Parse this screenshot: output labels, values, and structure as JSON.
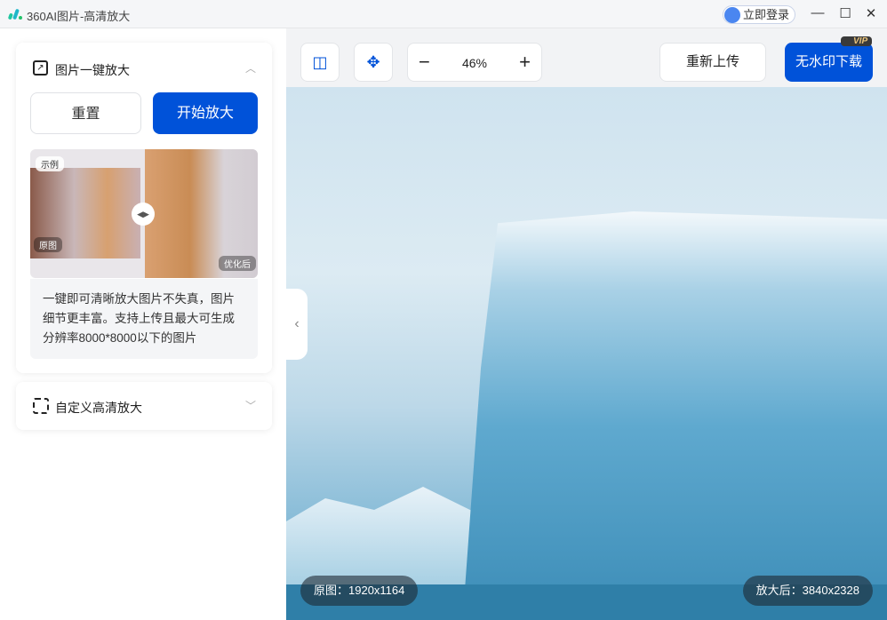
{
  "titlebar": {
    "title": "360AI图片-高清放大",
    "login": "立即登录",
    "minimize": "—",
    "maximize": "☐",
    "close": "✕"
  },
  "sidebar": {
    "section1": {
      "title": "图片一键放大",
      "reset": "重置",
      "start": "开始放大",
      "example_tag": "示例",
      "before_tag": "原图",
      "after_tag": "优化后",
      "description": "一键即可清晰放大图片不失真，图片细节更丰富。支持上传且最大可生成分辨率8000*8000以下的图片"
    },
    "section2": {
      "title": "自定义高清放大"
    }
  },
  "toolbar": {
    "zoom": "46%",
    "zoom_out": "−",
    "zoom_in": "+",
    "reupload": "重新上传",
    "download": "无水印下载",
    "vip_badge": "VIP"
  },
  "image": {
    "original": "原图：1920x1164",
    "enlarged": "放大后：3840x2328"
  },
  "colors": {
    "accent": "#0052d9"
  }
}
